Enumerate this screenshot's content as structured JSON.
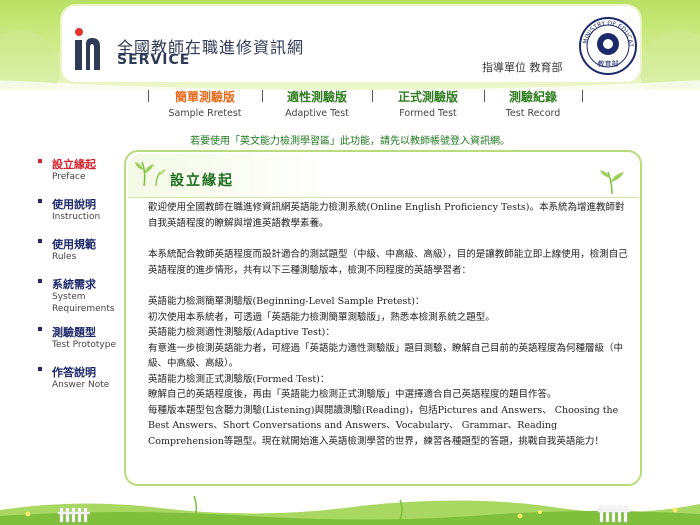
{
  "header": {
    "logo_mark": "in",
    "logo_title": "全國教師在職進修資訊網",
    "logo_service": "SERVICE",
    "supervisor": "指導單位  教育部",
    "seal_text_top": "MINISTRY OF EDUCATION",
    "seal_text_bottom": "教育部",
    "colors": {
      "header_green": "#b9df63",
      "title_navy": "#2e3a56"
    }
  },
  "tabs": [
    {
      "label_zh": "簡單測驗版",
      "label_en": "Sample Rretest",
      "active": true
    },
    {
      "label_zh": "適性測驗版",
      "label_en": "Adaptive Test",
      "active": false
    },
    {
      "label_zh": "正式測驗版",
      "label_en": "Formed Test",
      "active": false
    },
    {
      "label_zh": "測驗紀錄",
      "label_en": "Test Record",
      "active": false
    }
  ],
  "notice": "若要使用「英文能力檢測學習區」此功能，請先以教師帳號登入資訊網。",
  "sidebar": {
    "items": [
      {
        "label_zh": "設立緣起",
        "label_en": "Preface",
        "active": true
      },
      {
        "label_zh": "使用說明",
        "label_en": "Instruction",
        "active": false
      },
      {
        "label_zh": "使用規範",
        "label_en": "Rules",
        "active": false
      },
      {
        "label_zh": "系統需求",
        "label_en": "System Requirements",
        "active": false
      },
      {
        "label_zh": "測驗題型",
        "label_en": "Test Prototype",
        "active": false
      },
      {
        "label_zh": "作答說明",
        "label_en": "Answer Note",
        "active": false
      }
    ]
  },
  "panel": {
    "title": "設立緣起",
    "paragraphs": [
      "歡迎使用全國教師在職進修資訊網英語能力檢測系統(Online English Proficiency Tests)。本系統為增進教師對自我英語程度的瞭解與增進英語教學素養。",
      "本系統配合教師英語程度而設計適合的測試題型（中級、中高級、高級），目的是讓教師能立即上線使用，檢測自己英語程度的進步情形，共有以下三種測驗版本，檢測不同程度的英語學習者："
    ],
    "lines": [
      "英語能力檢測簡單測驗版(Beginning-Level Sample Pretest)：",
      "初次使用本系統者，可透過「英語能力檢測簡單測驗版」，熟悉本檢測系統之題型。",
      "英語能力檢測適性測驗版(Adaptive Test)：",
      "有意進一步檢測英語能力者，可經過「英語能力適性測驗版」題目測驗，瞭解自己目前的英語程度為何種層級（中級、中高級、高級）。",
      "英語能力檢測正式測驗版(Formed Test)：",
      "瞭解自己的英語程度後，再由「英語能力檢測正式測驗版」中選擇適合自己英語程度的題目作答。",
      "每種版本題型包含聽力測驗(Listening)與閱讀測驗(Reading)，包括Pictures and Answers、 Choosing the Best Answers、Short Conversations and Answers、Vocabulary、 Grammar、Reading Comprehension等題型。現在就開始進入英語檢測學習的世界，練習各種題型的答題，挑戰自我英語能力！"
    ]
  }
}
